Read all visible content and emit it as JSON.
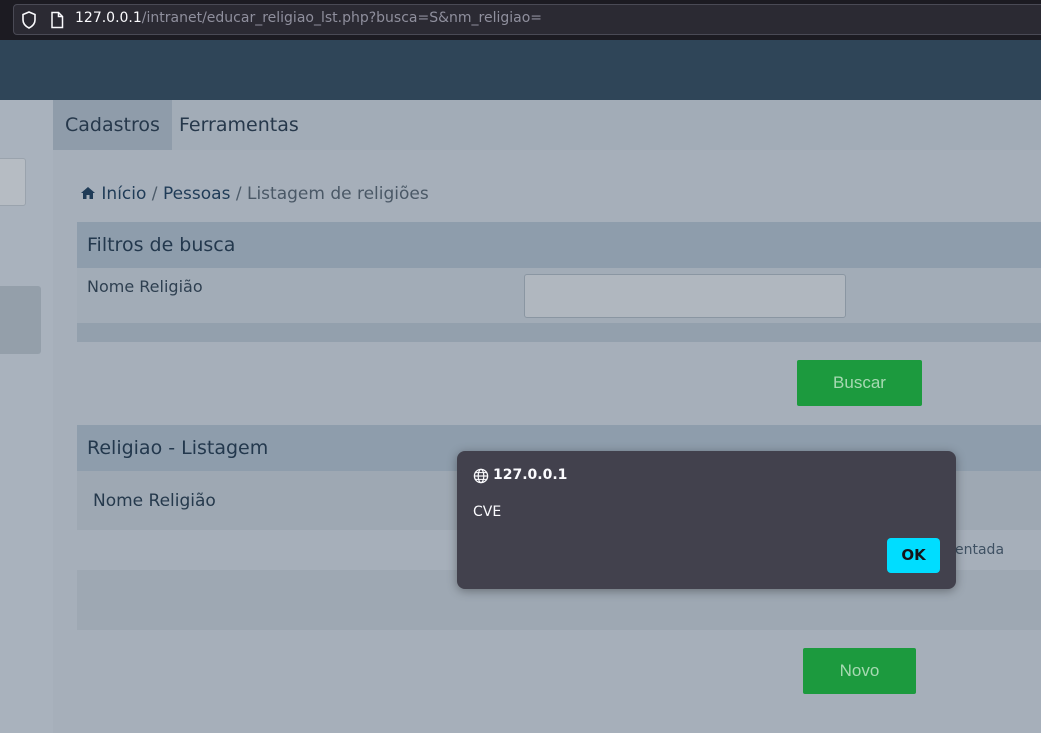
{
  "browser": {
    "url_host": "127.0.0.1",
    "url_path": "/intranet/educar_religiao_lst.php?busca=S&nm_religiao="
  },
  "nav": {
    "tabs": [
      {
        "label": "Cadastros"
      },
      {
        "label": "Ferramentas"
      }
    ]
  },
  "breadcrumb": {
    "home": "Início",
    "sep1": "/",
    "section": "Pessoas",
    "sep2": "/",
    "current": "Listagem de religiões"
  },
  "filters": {
    "title": "Filtros de busca",
    "name_label": "Nome Religião",
    "name_value": "",
    "search_button": "Buscar"
  },
  "listing": {
    "title": "Religiao - Listagem",
    "column": "Nome Religião",
    "note_partial": "entada",
    "new_button": "Novo"
  },
  "alert": {
    "host": "127.0.0.1",
    "message": "CVE",
    "ok_label": "OK"
  },
  "colors": {
    "header": "#2f4558",
    "button_green": "#1c9a3e",
    "ok_button": "#00ddff"
  }
}
